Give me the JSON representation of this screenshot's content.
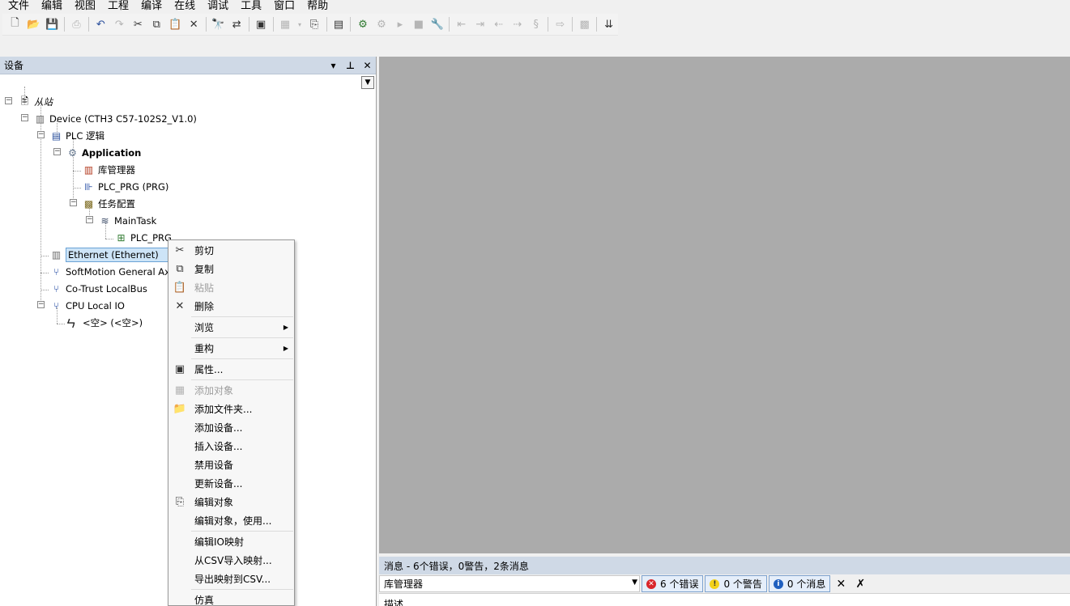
{
  "menubar": [
    "文件",
    "编辑",
    "视图",
    "工程",
    "编译",
    "在线",
    "调试",
    "工具",
    "窗口",
    "帮助"
  ],
  "devices_panel": {
    "title": "设备",
    "tree": {
      "root": "从站",
      "device": "Device (CTH3 C57-102S2_V1.0)",
      "plc_logic": "PLC 逻辑",
      "application": "Application",
      "library_manager": "库管理器",
      "plc_prg": "PLC_PRG (PRG)",
      "task_config": "任务配置",
      "main_task": "MainTask",
      "main_task_plc_prg": "PLC_PRG",
      "ethernet": "Ethernet (Ethernet)",
      "softmotion": "SoftMotion General Axis Pool",
      "localbus": "Co-Trust LocalBus",
      "cpu_local_io": "CPU Local IO",
      "empty_slot": "<空> (<空>)"
    }
  },
  "context_menu": {
    "cut": "剪切",
    "copy": "复制",
    "paste": "粘贴",
    "delete": "删除",
    "browse": "浏览",
    "refactor": "重构",
    "properties": "属性...",
    "add_object": "添加对象",
    "add_folder": "添加文件夹...",
    "add_device": "添加设备...",
    "insert_device": "插入设备...",
    "disable_device": "禁用设备",
    "update_device": "更新设备...",
    "edit_object": "编辑对象",
    "edit_object_with": "编辑对象，使用...",
    "edit_io_mapping": "编辑IO映射",
    "import_csv": "从CSV导入映射...",
    "export_csv": "导出映射到CSV...",
    "simulation": "仿真"
  },
  "messages": {
    "title": "消息 - 6个错误，0警告，2条消息",
    "source": "库管理器",
    "errors": "6 个错误",
    "warnings": "0 个警告",
    "infos": "0 个消息",
    "desc_header": "描述"
  },
  "colors": {
    "panel_header": "#cfd9e6",
    "editor_bg": "#ababab",
    "error": "#d9252b",
    "warning": "#f3d21a",
    "info": "#1f5fbf",
    "selection": "#cde4f7"
  }
}
